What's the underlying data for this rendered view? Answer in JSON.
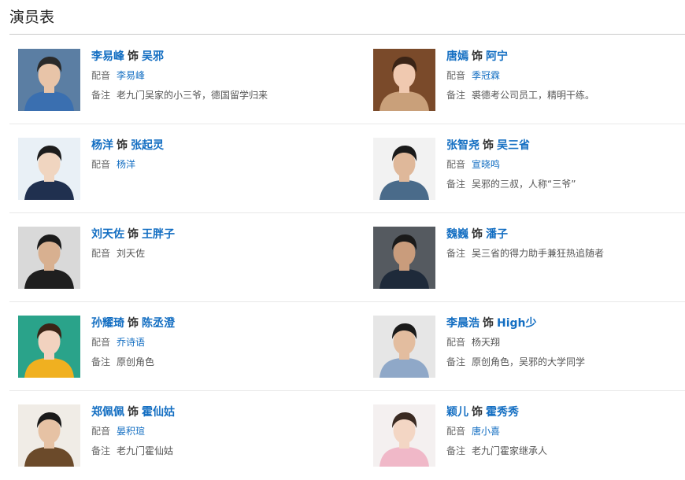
{
  "title": "演员表",
  "labels": {
    "as": "饰",
    "voice": "配音",
    "note": "备注"
  },
  "cast": [
    {
      "actor": "李易峰",
      "role": "吴邪",
      "voice": "李易峰",
      "voice_link": true,
      "note": "老九门吴家的小三爷，德国留学归来",
      "photo": {
        "bg": "#5b7ea3",
        "skin": "#e8c4a8",
        "hair": "#2a2a2a",
        "shirt": "#3a6fb0"
      }
    },
    {
      "actor": "唐嫣",
      "role": "阿宁",
      "voice": "季冠霖",
      "voice_link": true,
      "note": "裘德考公司员工，精明干练。",
      "photo": {
        "bg": "#7a4a2a",
        "skin": "#f0c9b0",
        "hair": "#3b2416",
        "shirt": "#c9a07a"
      }
    },
    {
      "actor": "杨洋",
      "role": "张起灵",
      "voice": "杨洋",
      "voice_link": true,
      "note": "",
      "photo": {
        "bg": "#e9f0f6",
        "skin": "#f0d5c0",
        "hair": "#1c1c1c",
        "shirt": "#20304f"
      }
    },
    {
      "actor": "张智尧",
      "role": "吴三省",
      "voice": "宣晓鸣",
      "voice_link": true,
      "note": "吴邪的三叔，人称“三爷”",
      "photo": {
        "bg": "#f2f2f2",
        "skin": "#dfb89a",
        "hair": "#1a1a1a",
        "shirt": "#4a6b8a"
      }
    },
    {
      "actor": "刘天佐",
      "role": "王胖子",
      "voice": "刘天佐",
      "voice_link": false,
      "note": "",
      "photo": {
        "bg": "#d9d9d9",
        "skin": "#d8b090",
        "hair": "#1a1a1a",
        "shirt": "#1f1f1f"
      }
    },
    {
      "actor": "魏巍",
      "role": "潘子",
      "voice": "",
      "voice_link": false,
      "note": "吴三省的得力助手兼狂热追随者",
      "photo": {
        "bg": "#555a60",
        "skin": "#c99c7c",
        "hair": "#1a1a1a",
        "shirt": "#1e2a3a"
      }
    },
    {
      "actor": "孙耀琦",
      "role": "陈丞澄",
      "voice": "乔诗语",
      "voice_link": true,
      "note": "原创角色",
      "photo": {
        "bg": "#2aa38a",
        "skin": "#f2d2bf",
        "hair": "#3b2416",
        "shirt": "#f0b020"
      }
    },
    {
      "actor": "李晨浩",
      "role": "High少",
      "voice": "杨天翔",
      "voice_link": false,
      "note": "原创角色，吴邪的大学同学",
      "photo": {
        "bg": "#e6e6e6",
        "skin": "#e3bd9f",
        "hair": "#1a1a1a",
        "shirt": "#8fa8c8"
      }
    },
    {
      "actor": "郑佩佩",
      "role": "霍仙姑",
      "voice": "晏积瑄",
      "voice_link": true,
      "note": "老九门霍仙姑",
      "photo": {
        "bg": "#f0ece6",
        "skin": "#e6c2a4",
        "hair": "#1a1a1a",
        "shirt": "#6b4a2a"
      }
    },
    {
      "actor": "颖儿",
      "role": "霍秀秀",
      "voice": "唐小喜",
      "voice_link": true,
      "note": "老九门霍家继承人",
      "photo": {
        "bg": "#f4f0f0",
        "skin": "#f3d6c4",
        "hair": "#3a2a22",
        "shirt": "#f0b8c8"
      }
    }
  ]
}
